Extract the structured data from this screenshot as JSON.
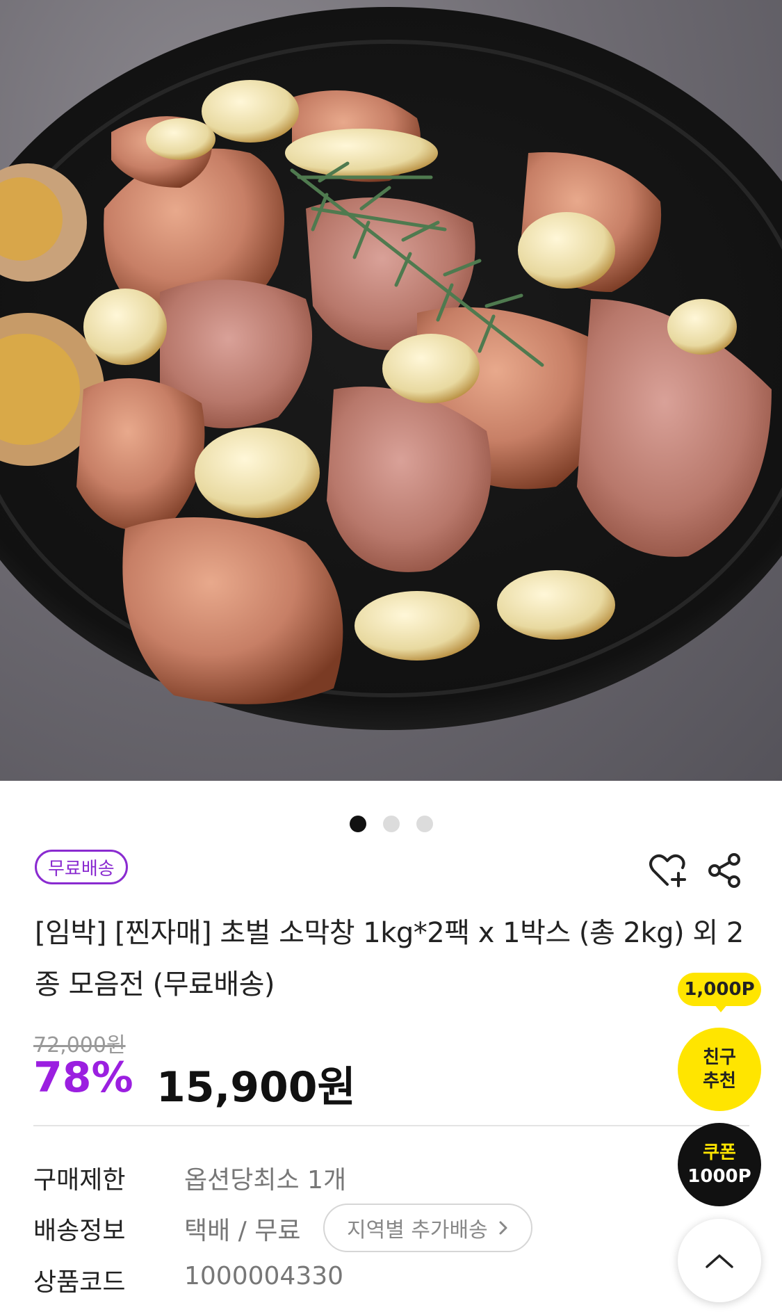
{
  "pager": {
    "count": 3,
    "active_index": 0
  },
  "badge": {
    "label": "무료배송"
  },
  "actions": {
    "wishlist_icon": "heart-plus-icon",
    "share_icon": "share-icon"
  },
  "product": {
    "title": "[임박] [찐자매] 초벌 소막창 1kg*2팩 x 1박스 (총 2kg) 외 2종 모음전 (무료배송)",
    "original_price": "72,000원",
    "discount_rate": "78%",
    "price": "15,900원"
  },
  "info": {
    "limit_label": "구매제한",
    "limit_value": "옵션당최소 1개",
    "shipping_label": "배송정보",
    "shipping_value": "택배 / 무료",
    "region_button": "지역별 추가배송",
    "code_label": "상품코드",
    "code_value": "1000004330"
  },
  "floating": {
    "points": "1,000P",
    "friend_line1": "친구",
    "friend_line2": "추천",
    "coupon_line1": "쿠폰",
    "coupon_line2": "1000P",
    "top_icon": "chevron-up-icon"
  },
  "colors": {
    "accent_purple": "#9b1fe0",
    "badge_purple": "#8a2bd0",
    "yellow": "#ffe500"
  }
}
